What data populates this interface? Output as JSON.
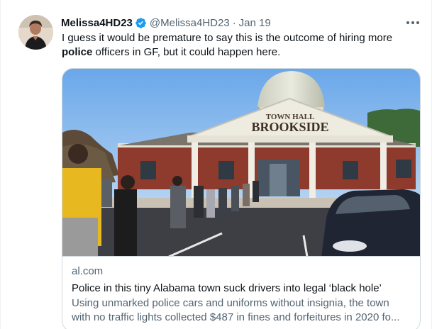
{
  "tweet": {
    "author_name": "Melissa4HD23",
    "handle": "@Melissa4HD23",
    "separator": "·",
    "date": "Jan 19",
    "text_before": "I guess it would be premature to say this is the outcome of hiring more ",
    "text_bold": "police",
    "text_after": " officers in GF, but it could happen here.",
    "verified_icon": "verified-badge-icon",
    "more_icon": "more-options-icon"
  },
  "card": {
    "domain": "al.com",
    "title": "Police in this tiny Alabama town suck drivers into legal ‘black hole’",
    "description_line1": "Using unmarked police cars and uniforms without insignia, the town",
    "description_line2": "with no traffic lights collected $487 in fines and forfeitures in 2020 fo...",
    "image": {
      "sign_line1": "TOWN HALL",
      "sign_line2": "BROOKSIDE"
    }
  },
  "colors": {
    "verified_blue": "#1d9bf0",
    "text_primary": "#0f1419",
    "text_secondary": "#536471",
    "border": "#cfd9de"
  }
}
